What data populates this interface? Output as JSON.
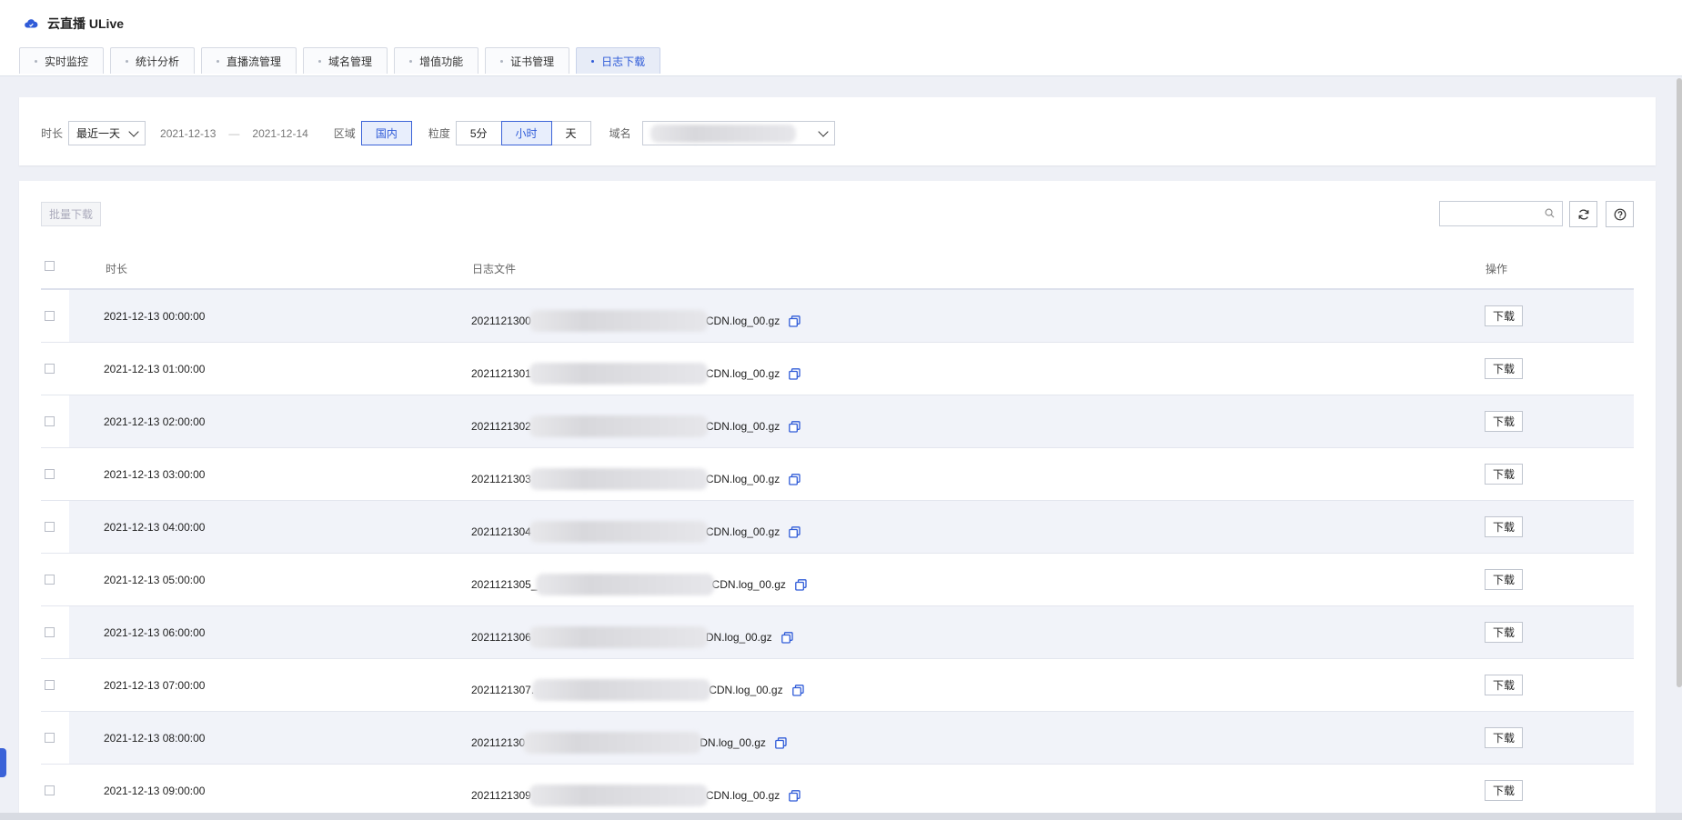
{
  "app": {
    "title": "云直播 ULive"
  },
  "tabs": [
    {
      "label": "实时监控"
    },
    {
      "label": "统计分析"
    },
    {
      "label": "直播流管理"
    },
    {
      "label": "域名管理"
    },
    {
      "label": "增值功能"
    },
    {
      "label": "证书管理"
    },
    {
      "label": "日志下载",
      "active": true
    }
  ],
  "filters": {
    "duration_label": "时长",
    "duration_value": "最近一天",
    "date_start": "2021-12-13",
    "date_sep": "—",
    "date_end": "2021-12-14",
    "region_label": "区域",
    "region_value": "国内",
    "granularity_label": "粒度",
    "granularity_options": [
      "5分",
      "小时",
      "天"
    ],
    "granularity_selected": "小时",
    "domain_label": "域名"
  },
  "toolbar": {
    "batch_download": "批量下载",
    "search_placeholder": ""
  },
  "table": {
    "columns": {
      "time": "时长",
      "file": "日志文件",
      "action": "操作"
    },
    "rows": [
      {
        "time": "2021-12-13 00:00:00",
        "file_prefix": "2021121300",
        "file_suffix": "CDN.log_00.gz",
        "action": "下载"
      },
      {
        "time": "2021-12-13 01:00:00",
        "file_prefix": "2021121301",
        "file_suffix": "CDN.log_00.gz",
        "action": "下载"
      },
      {
        "time": "2021-12-13 02:00:00",
        "file_prefix": "2021121302",
        "file_suffix": "CDN.log_00.gz",
        "action": "下载"
      },
      {
        "time": "2021-12-13 03:00:00",
        "file_prefix": "2021121303",
        "file_suffix": "CDN.log_00.gz",
        "action": "下载"
      },
      {
        "time": "2021-12-13 04:00:00",
        "file_prefix": "2021121304",
        "file_suffix": "CDN.log_00.gz",
        "action": "下载"
      },
      {
        "time": "2021-12-13 05:00:00",
        "file_prefix": "2021121305_",
        "file_suffix": "CDN.log_00.gz",
        "action": "下载"
      },
      {
        "time": "2021-12-13 06:00:00",
        "file_prefix": "2021121306",
        "file_suffix": "DN.log_00.gz",
        "action": "下载"
      },
      {
        "time": "2021-12-13 07:00:00",
        "file_prefix": "2021121307.",
        "file_suffix": "CDN.log_00.gz",
        "action": "下载"
      },
      {
        "time": "2021-12-13 08:00:00",
        "file_prefix": "202112130",
        "file_suffix": "DN.log_00.gz",
        "action": "下载"
      },
      {
        "time": "2021-12-13 09:00:00",
        "file_prefix": "2021121309",
        "file_suffix": "CDN.log_00.gz",
        "action": "下载"
      }
    ]
  },
  "colors": {
    "accent": "#2f5bd8",
    "stripe": "#f1f3f9",
    "background": "#eef0f6"
  },
  "icons": {
    "logo": "cloud-icon",
    "search": "search-icon",
    "refresh": "refresh-icon",
    "help": "help-icon",
    "copy": "copy-icon",
    "dropdown": "chevron-down-icon"
  }
}
